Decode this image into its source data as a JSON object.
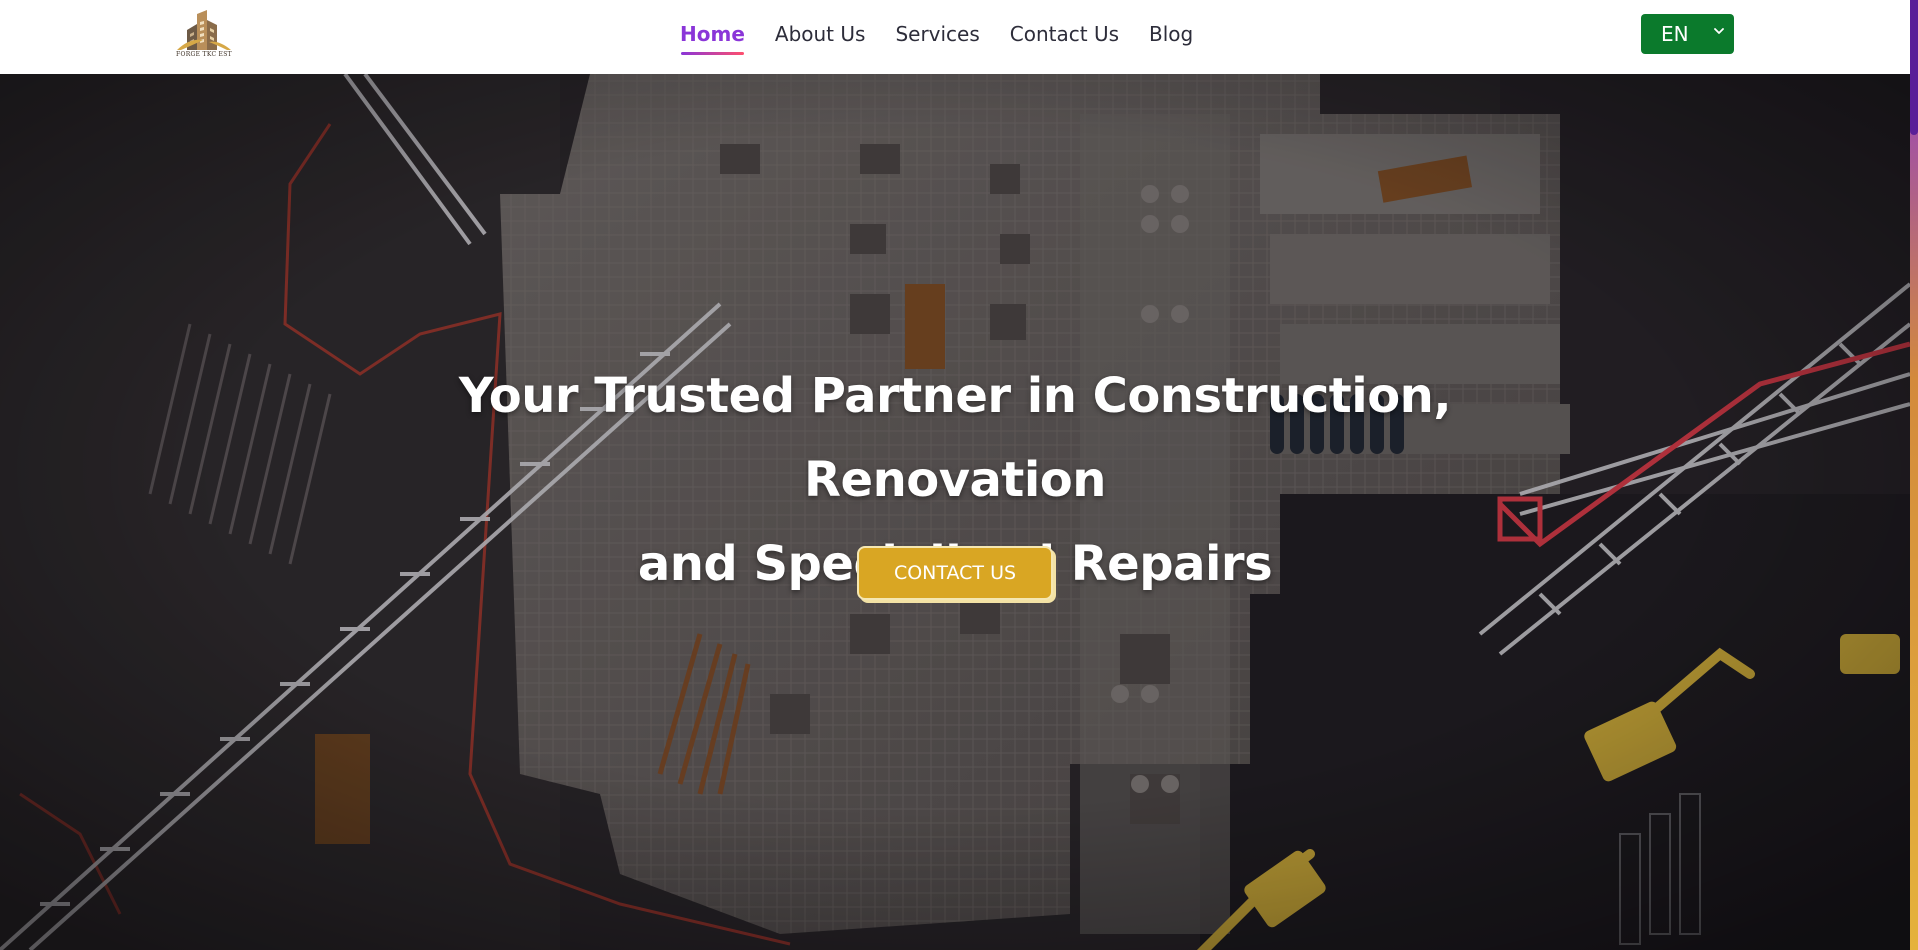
{
  "brand": {
    "logo_text": "FORGE TKC EST"
  },
  "nav": {
    "items": [
      {
        "label": "Home",
        "active": true
      },
      {
        "label": "About Us",
        "active": false
      },
      {
        "label": "Services",
        "active": false
      },
      {
        "label": "Contact Us",
        "active": false
      },
      {
        "label": "Blog",
        "active": false
      }
    ],
    "language": {
      "selected": "EN",
      "icon": "chevron-down-icon"
    }
  },
  "hero": {
    "title_line1": "Your Trusted Partner in Construction, Renovation",
    "title_line2": "and Specialized Repairs",
    "cta_label": "CONTACT US"
  },
  "colors": {
    "nav_active": "#8a35d8",
    "nav_active_underline_end": "#ff4f6d",
    "nav_text": "#2d2d3a",
    "language_button": "#0b7a2c",
    "cta": "#d9a623",
    "scrollbar_thumb": "#5a1f98"
  }
}
